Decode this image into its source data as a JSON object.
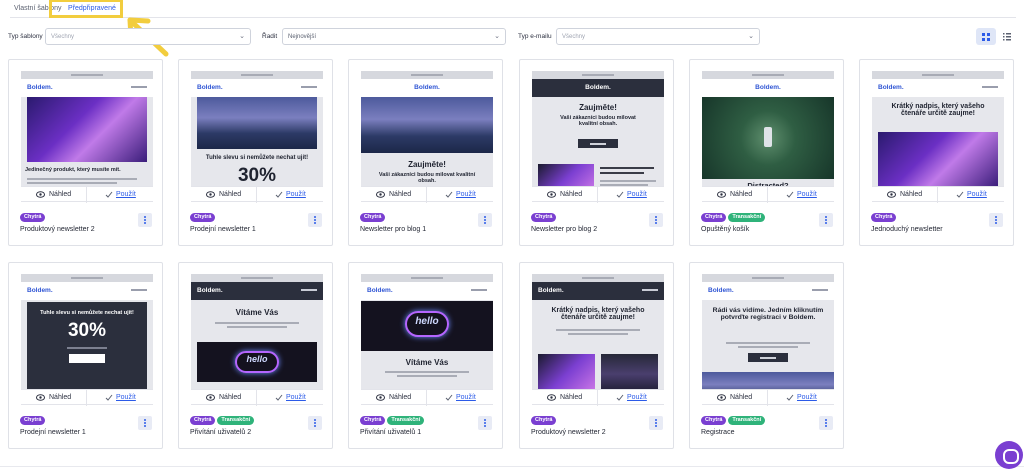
{
  "tabs": [
    {
      "label": "Vlastní šablony"
    },
    {
      "label": "Předpřipravené"
    }
  ],
  "filters": {
    "type_label": "Typ šablony",
    "type_value": "Všechny",
    "sort_label": "Řadit",
    "sort_value": "Nejnovější",
    "email_label": "Typ e-mailu",
    "email_value": "Všechny"
  },
  "card_actions": {
    "preview_label": "Náhled",
    "use_label": "Použít"
  },
  "badges": {
    "smart": "Chytrá",
    "transactional": "Transakční"
  },
  "cards": [
    {
      "name": "Produktový newsletter 2",
      "tags": [
        "Chytrá"
      ],
      "thumb_logo": "Boldem.",
      "thumb_heading": "Jedinečný produkt, který musíte mít."
    },
    {
      "name": "Prodejní newsletter 1",
      "tags": [
        "Chytrá"
      ],
      "thumb_logo": "Boldem.",
      "thumb_heading": "Tuhle slevu si nemůžete nechat ujít!",
      "thumb_big": "30%"
    },
    {
      "name": "Newsletter pro blog 1",
      "tags": [
        "Chytrá"
      ],
      "thumb_logo": "Boldem.",
      "thumb_heading": "Zaujměte!",
      "thumb_sub": "Vaši zákazníci budou milovat kvalitní obsah."
    },
    {
      "name": "Newsletter pro blog 2",
      "tags": [
        "Chytrá"
      ],
      "thumb_logo": "Boldem.",
      "thumb_heading": "Zaujměte!",
      "thumb_sub": "Vaši zákazníci budou milovat kvalitní obsah."
    },
    {
      "name": "Opuštěný košík",
      "tags": [
        "Chytrá",
        "Transakční"
      ],
      "thumb_logo": "Boldem.",
      "thumb_heading": "Distracted?"
    },
    {
      "name": "Jednoduchý newsletter",
      "tags": [
        "Chytrá"
      ],
      "thumb_logo": "Boldem.",
      "thumb_heading": "Krátký nadpis, který vašeho čtenáře určitě zaujme!"
    },
    {
      "name": "Prodejní newsletter 1",
      "tags": [
        "Chytrá"
      ],
      "thumb_logo": "Boldem.",
      "thumb_heading": "Tuhle slevu si nemůžete nechat ujít!",
      "thumb_big": "30%"
    },
    {
      "name": "Přivítání uživatelů 2",
      "tags": [
        "Chytrá",
        "Transakční"
      ],
      "thumb_logo": "Boldem.",
      "thumb_heading": "Vítáme Vás",
      "thumb_neon": "hello"
    },
    {
      "name": "Přivítání uživatelů 1",
      "tags": [
        "Chytrá",
        "Transakční"
      ],
      "thumb_logo": "Boldem.",
      "thumb_heading": "Vítáme Vás",
      "thumb_neon": "hello"
    },
    {
      "name": "Produktový newsletter 2",
      "tags": [
        "Chytrá"
      ],
      "thumb_logo": "Boldem.",
      "thumb_heading": "Krátký nadpis, který vašeho čtenáře určitě zaujme!"
    },
    {
      "name": "Registrace",
      "tags": [
        "Chytrá",
        "Transakční"
      ],
      "thumb_logo": "Boldem.",
      "thumb_heading": "Rádi vás vidíme. Jedním kliknutím potvrďte registraci v Boldem."
    }
  ],
  "colors": {
    "accent": "#2c5be8",
    "smart_badge": "#7a3fd1",
    "transactional_badge": "#2fb37a",
    "highlight": "#f2cd3e"
  }
}
